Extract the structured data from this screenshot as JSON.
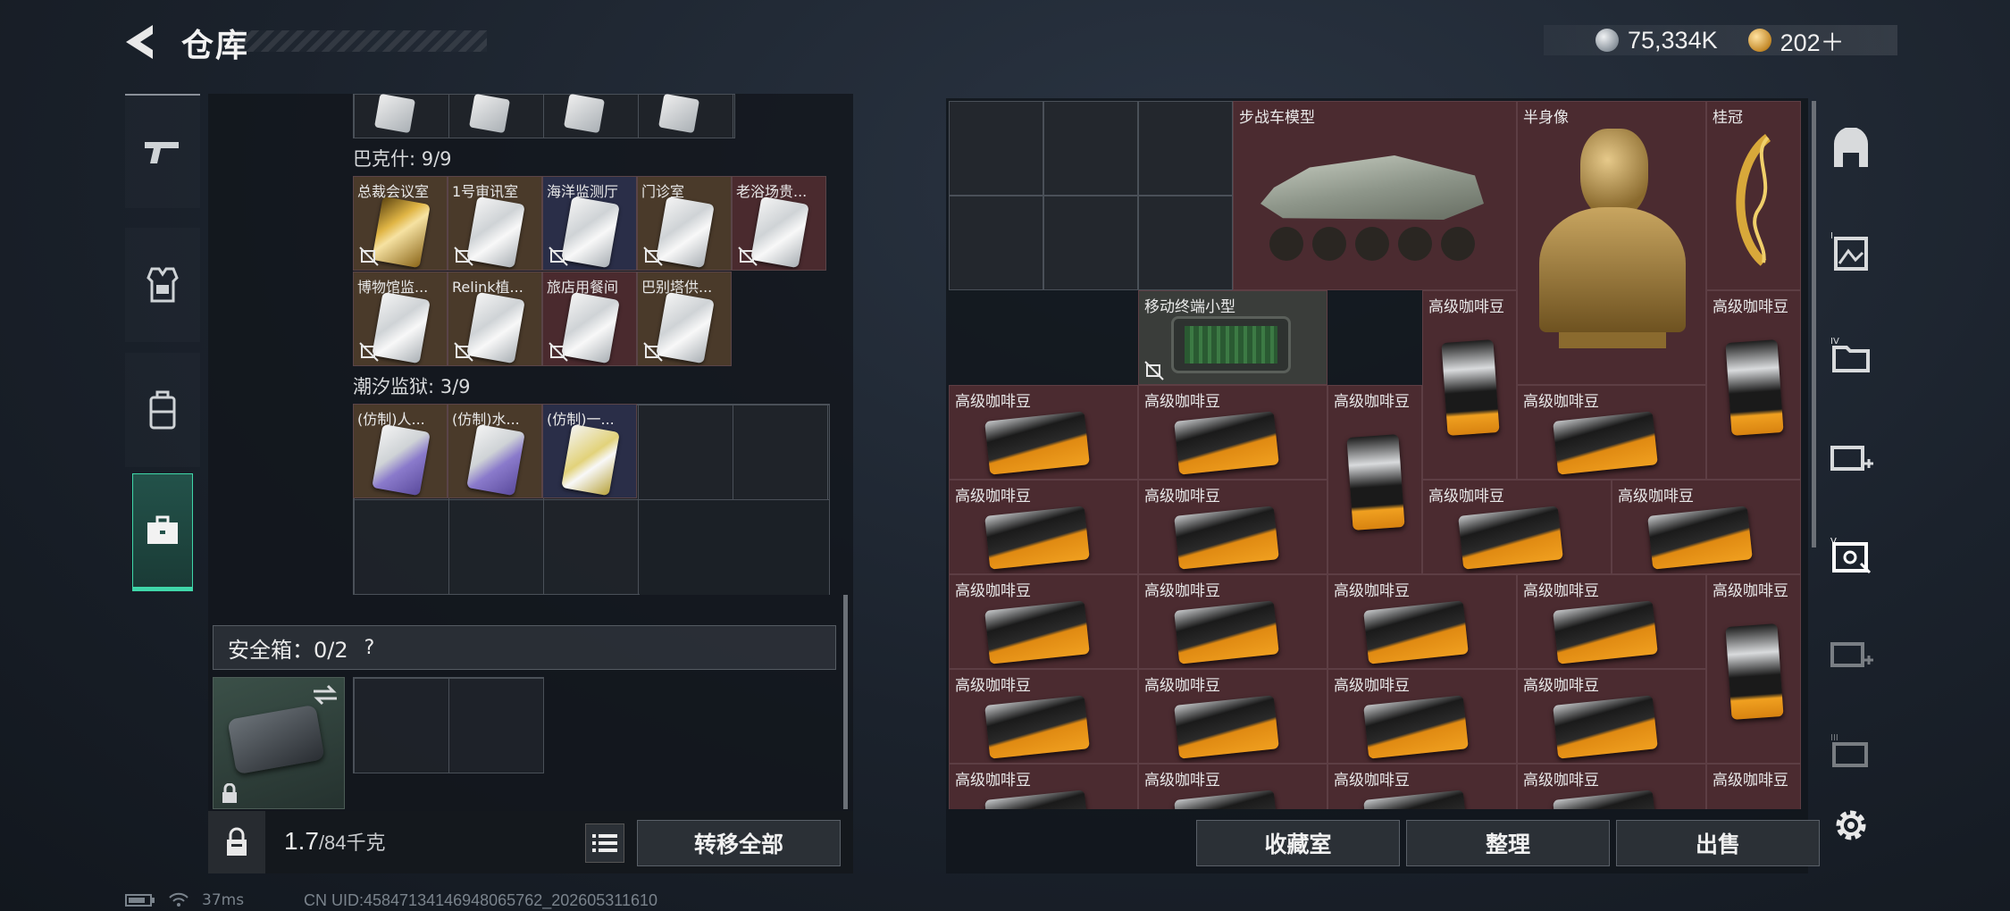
{
  "header": {
    "title": "仓库",
    "currency_silver": "75,334K",
    "currency_gold": "202＋"
  },
  "left": {
    "sections": [
      {
        "title": "巴克什: 9/9"
      },
      {
        "title": "潮汐监狱: 3/9"
      }
    ],
    "bakshi_cards": [
      {
        "name": "总裁会议室",
        "style": "gold",
        "bg": "brown"
      },
      {
        "name": "1号审讯室",
        "style": "silver",
        "bg": "brown"
      },
      {
        "name": "海洋监测厅",
        "style": "silver",
        "bg": "navy"
      },
      {
        "name": "门诊室",
        "style": "silver",
        "bg": "brown"
      },
      {
        "name": "老浴场贵...",
        "style": "silver",
        "bg": "red"
      },
      {
        "name": "博物馆监...",
        "style": "silver",
        "bg": "brown"
      },
      {
        "name": "Relink植...",
        "style": "silver",
        "bg": "brown"
      },
      {
        "name": "旅店用餐间",
        "style": "silver",
        "bg": "red"
      },
      {
        "name": "巴别塔供...",
        "style": "silver",
        "bg": "brown"
      }
    ],
    "tidal_cards": [
      {
        "name": "(仿制)人...",
        "style": "purple",
        "bg": "brown"
      },
      {
        "name": "(仿制)水...",
        "style": "purple",
        "bg": "brown"
      },
      {
        "name": "(仿制)一...",
        "style": "yellow",
        "bg": "navy"
      }
    ],
    "safebox": {
      "label": "安全箱：0/2",
      "help": "?"
    },
    "weight_value": "1.7",
    "weight_unit": "/84千克",
    "transfer_label": "转移全部"
  },
  "right": {
    "items": [
      {
        "name": "步战车模型"
      },
      {
        "name": "半身像"
      },
      {
        "name": "桂冠"
      },
      {
        "name": "移动终端小型"
      },
      {
        "name": "高级咖啡豆"
      }
    ],
    "buttons": {
      "collection": "收藏室",
      "sort": "整理",
      "sell": "出售"
    }
  },
  "status": {
    "ping": "37ms",
    "uid": "CN UID:4584713414694806576​2_202605311610"
  },
  "colors": {
    "accent": "#3fd7a9",
    "item_red_bg": "#4b2b30"
  }
}
